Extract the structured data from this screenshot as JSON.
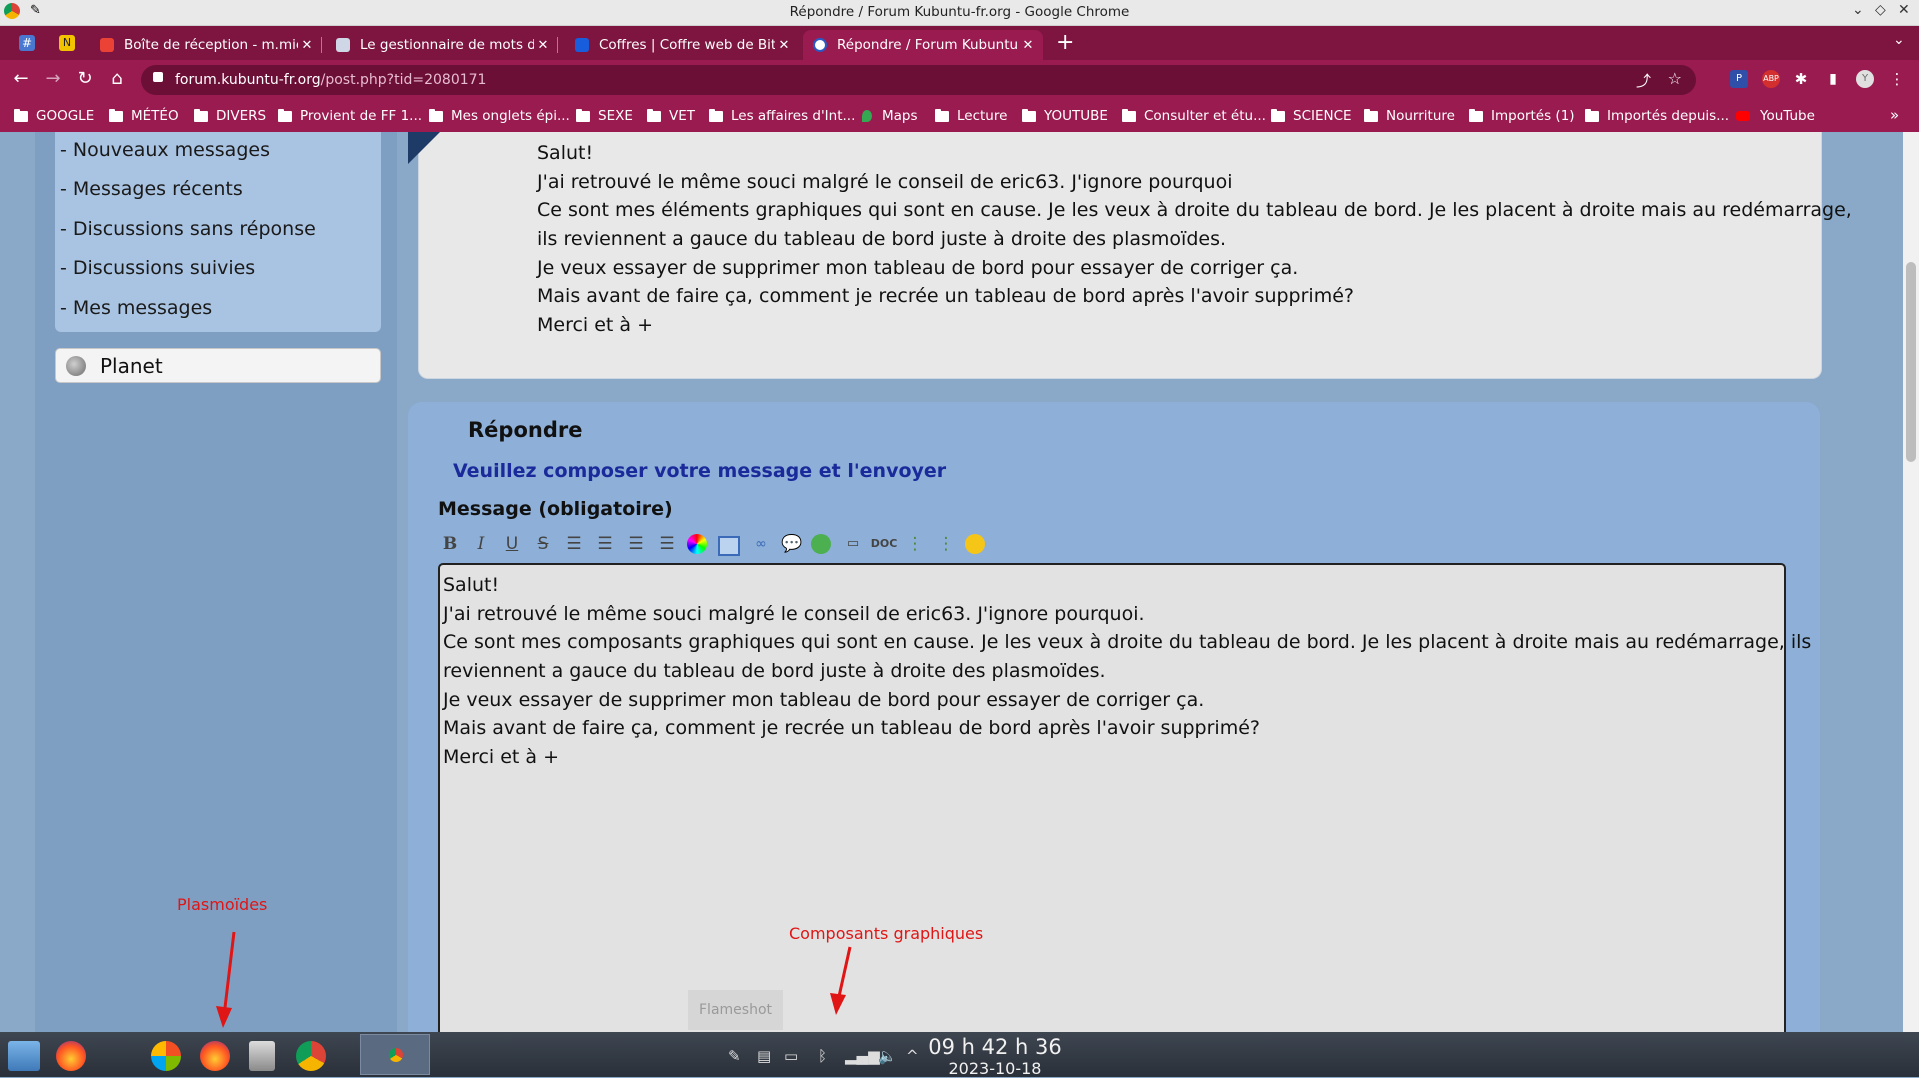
{
  "window": {
    "title": "Répondre / Forum Kubuntu-fr.org - Google Chrome"
  },
  "tabs": [
    {
      "label": "Boîte de réception - m.mich",
      "color": "#ea4335"
    },
    {
      "label": "Le gestionnaire de mots de",
      "color": "#3b5ea8"
    },
    {
      "label": "Coffres | Coffre web de Bitw",
      "color": "#175ddc"
    },
    {
      "label": "Répondre / Forum Kubuntu",
      "color": "#2b59c3",
      "active": true
    }
  ],
  "address": {
    "host": "forum.kubuntu-fr.org",
    "path": "/post.php?tid=2080171"
  },
  "bookmarks": [
    "GOOGLE",
    "MÉTÉO",
    "DIVERS",
    "Provient de FF 1...",
    "Mes onglets épi...",
    "SEXE",
    "VET",
    "Les affaires d'Int...",
    "Maps",
    "Lecture",
    "YOUTUBE",
    "Consulter et étu...",
    "SCIENCE",
    "Nourriture",
    "Importés (1)",
    "Importés depuis...",
    "YouTube"
  ],
  "sidebar": {
    "items": [
      "- Nouveaux messages",
      "- Messages récents",
      "- Discussions sans réponse",
      "- Discussions suivies",
      "- Mes messages"
    ],
    "planet": "Planet"
  },
  "post": {
    "lines": [
      "Salut!",
      "J'ai retrouvé le même souci malgré le conseil de eric63. J'ignore pourquoi",
      "Ce sont mes éléments graphiques qui sont en cause. Je les veux à droite du tableau de bord. Je les placent à droite mais au redémarrage,",
      "ils reviennent a gauce du tableau de bord  juste à droite des plasmoïdes.",
      "Je veux essayer de supprimer mon tableau de bord pour essayer de corriger ça.",
      "Mais avant de faire ça, comment je recrée un tableau de bord après l'avoir supprimé?",
      "Merci et à +"
    ]
  },
  "reply": {
    "title": "Répondre",
    "subtitle": "Veuillez composer votre message et l'envoyer",
    "message_label": "Message (obligatoire)",
    "editor_lines": [
      "Salut!",
      "J'ai retrouvé le même souci malgré le conseil de eric63. J'ignore pourquoi.",
      "Ce sont mes composants graphiques qui sont en cause. Je les veux à droite du tableau de bord. Je les placent à droite mais au redémarrage, ils",
      "reviennent a gauce du tableau de bord  juste à droite des plasmoïdes.",
      "Je veux essayer de supprimer mon tableau de bord pour essayer de corriger ça.",
      "Mais avant de faire ça, comment je recrée un tableau de bord après l'avoir supprimé?",
      "Merci et à +"
    ],
    "toolbar": [
      "bold-icon",
      "italic-icon",
      "underline-icon",
      "strikethrough-icon",
      "align-left-icon",
      "align-right-icon",
      "align-center-icon",
      "justify-icon",
      "color-icon",
      "image-icon",
      "link-icon",
      "quote-icon",
      "web-icon",
      "video-icon",
      "doc-icon",
      "list-icon",
      "ordered-list-icon",
      "smiley-icon"
    ],
    "toolbar_text": {
      "bold": "B",
      "italic": "I",
      "underline": "U",
      "strike": "S",
      "doc": "DOC"
    }
  },
  "annotations": {
    "plasmoides": "Plasmoïdes",
    "composants": "Composants graphiques"
  },
  "flameshot": "Flameshot",
  "clock": {
    "time": "09 h 42 h 36",
    "date": "2023-10-18"
  },
  "colors": {
    "accent": "#9a1b50",
    "tabstrip": "#7d1540",
    "annotation": "#e01515",
    "reply_subtitle": "#1a2a9a"
  }
}
